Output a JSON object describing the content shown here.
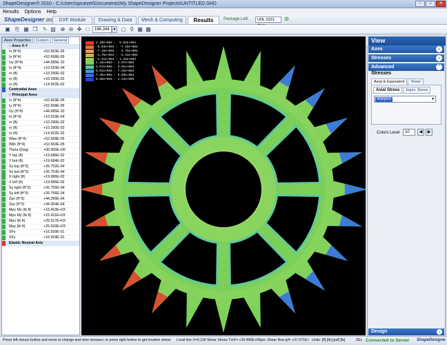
{
  "window": {
    "title": "ShapeDesigner® 2010 - C:\\Users\\qzuezet\\Documents\\My ShapeDesigner Projects\\UNTITLED.SHD"
  },
  "menu": [
    "Results",
    "Options",
    "Help"
  ],
  "brand": {
    "name": "ShapeDesigner",
    "year": "2010"
  },
  "module_tabs": [
    {
      "label": "DXF Module"
    },
    {
      "label": "Drawing & Data"
    },
    {
      "label": "Mesh & Computing"
    },
    {
      "label": "Results",
      "active": true
    }
  ],
  "package": {
    "label": "Package Left:",
    "value": "UNL  1023 days"
  },
  "toolbar": {
    "icons": [
      "save-icon",
      "print-icon",
      "preview-icon",
      "pencil-icon",
      "grid-icon",
      "zoom-in-icon",
      "zoom-out-icon",
      "pan-icon",
      "zoom-window-icon"
    ],
    "zoom_value": "166.344"
  },
  "left_panel": {
    "tabs": [
      "Axes Properties",
      "Custom",
      "General"
    ],
    "rows": [
      {
        "kind": "section",
        "name": "Axes X-Y",
        "expanded": true
      },
      {
        "kind": "item",
        "mark": "g",
        "name": "Ix      (ft^4)",
        "value": "+52.663E-05"
      },
      {
        "kind": "item",
        "mark": "g",
        "name": "Iy      (ft^4)",
        "value": "+52.668E-05"
      },
      {
        "kind": "item",
        "mark": "g",
        "name": "Ixy     (ft^4)",
        "value": "+44.685E-10"
      },
      {
        "kind": "item",
        "mark": "g",
        "name": "Io      (ft^4)",
        "value": "+10.533E-04"
      },
      {
        "kind": "item",
        "mark": "g",
        "name": "rx      (ft)",
        "value": "+10.290E-02"
      },
      {
        "kind": "item",
        "mark": "g",
        "name": "ry      (ft)",
        "value": "+10.290E-02"
      },
      {
        "kind": "item",
        "mark": "g",
        "name": "ro      (ft)",
        "value": "+14.552E-02"
      },
      {
        "kind": "section",
        "mark": "b",
        "name": "Centroidal Axes"
      },
      {
        "kind": "section",
        "name": "Principal Axes",
        "expanded": true
      },
      {
        "kind": "item",
        "mark": "g",
        "name": "Ix      (ft^4)",
        "value": "+52.663E-05"
      },
      {
        "kind": "item",
        "mark": "g",
        "name": "Iy      (ft^4)",
        "value": "+52.668E-05"
      },
      {
        "kind": "item",
        "mark": "g",
        "name": "Ixy     (ft^4)",
        "value": "+44.685E-10"
      },
      {
        "kind": "item",
        "mark": "g",
        "name": "Io      (ft^4)",
        "value": "+10.533E-04"
      },
      {
        "kind": "item",
        "mark": "g",
        "name": "rx      (ft)",
        "value": "+10.290E-02"
      },
      {
        "kind": "item",
        "mark": "g",
        "name": "ry      (ft)",
        "value": "+10.290E-02"
      },
      {
        "kind": "item",
        "mark": "g",
        "name": "ro      (ft)",
        "value": "+14.552E-02"
      },
      {
        "kind": "item",
        "mark": "g",
        "name": "IMax    (ft^4)",
        "value": "+52.668E-05"
      },
      {
        "kind": "item",
        "mark": "g",
        "name": "IMin    (ft^4)",
        "value": "+52.663E-05"
      },
      {
        "kind": "item",
        "mark": "g",
        "name": "Theta (Deg)",
        "value": "+00.000E+00"
      },
      {
        "kind": "item",
        "mark": "g",
        "name": "Y top   (ft)",
        "value": "+19.686E-02"
      },
      {
        "kind": "item",
        "mark": "g",
        "name": "Y bot   (ft)",
        "value": "+19.684E-02"
      },
      {
        "kind": "item",
        "mark": "g",
        "name": "Sx top  (ft^3)",
        "value": "+26.752E-04"
      },
      {
        "kind": "item",
        "mark": "g",
        "name": "Sx bot  (ft^3)",
        "value": "+26.753E-04"
      },
      {
        "kind": "item",
        "mark": "g",
        "name": "X right (ft)",
        "value": "+19.686E-02"
      },
      {
        "kind": "item",
        "mark": "g",
        "name": "X left  (ft)",
        "value": "+19.685E-02"
      },
      {
        "kind": "item",
        "mark": "g",
        "name": "Sy right (ft^3)",
        "value": "+26.755E-04"
      },
      {
        "kind": "item",
        "mark": "g",
        "name": "Sy left (ft^3)",
        "value": "+26.756E-04"
      },
      {
        "kind": "item",
        "mark": "g",
        "name": "Zpx     (ft^3)",
        "value": "+44.299E-04"
      },
      {
        "kind": "item",
        "mark": "g",
        "name": "Zpy     (ft^3)",
        "value": "+44.304E-04"
      },
      {
        "kind": "item",
        "mark": "g",
        "name": "Mpx Mx (lb ft)",
        "value": "+15.410E+03"
      },
      {
        "kind": "item",
        "mark": "g",
        "name": "Mpx My (lb ft)",
        "value": "+15.411E+03"
      },
      {
        "kind": "item",
        "mark": "g",
        "name": "Mpx     (lb ft)",
        "value": "+25.517E+03"
      },
      {
        "kind": "item",
        "mark": "g",
        "name": "Mpy     (lb ft)",
        "value": "+25.520E+03"
      },
      {
        "kind": "item",
        "mark": "g",
        "name": "SFx",
        "value": "+16.559E-01"
      },
      {
        "kind": "item",
        "mark": "g",
        "name": "SFy",
        "value": "+16.559E-01"
      },
      {
        "kind": "section",
        "mark": "r",
        "name": "Elastic Neutral Axis"
      }
    ]
  },
  "legend": {
    "colors": [
      "#e83a2a",
      "#ee6b3c",
      "#f09848",
      "#c8b84c",
      "#9acd56",
      "#78d25a",
      "#58c9a2",
      "#3f9ae0",
      "#2f6cf0",
      "#2446d8"
    ],
    "labels": [
      "1.20e+004 : -9.63e+004",
      "-9.63e+004 : -7.19e+004",
      "-7.19e+004 : -4.75e+004",
      "-4.75e+004 : -2.31e+004",
      "-2.31e+004 : 1.33e+003",
      "1.33e+003 : 2.57e+004",
      "2.57e+004 : 5.01e+004",
      "5.01e+004 : 7.45e+004",
      "7.45e+004 : 9.89e+004",
      "9.89e+004 : 1.23e+005"
    ]
  },
  "right_panel": {
    "title": "View",
    "sections": [
      "Axes",
      "Stresses",
      "Advanced"
    ],
    "stresses_label": "Stresses",
    "tabs": [
      "Axial & Equivalent",
      "Shear"
    ],
    "subtabs": [
      "Axial Stress",
      "Equiv. Stress"
    ],
    "warp_select": "Warped",
    "colors_level_label": "Colors Level",
    "colors_level_value": "10",
    "design_label": "Design"
  },
  "status": {
    "hint": "Press left mouse button and move to change and view stresses; or press right button to get location stress",
    "local": "Local line X=0.11ft Shear Stress Tx/X= +29.496E+00psi- Shear flow q/l= +27.071E-01lb/ft",
    "units": "Units: [ft] [lb] [psf] [lb]",
    "server_prefix": "ZEL",
    "server": "Connected to Server",
    "logo": "ShapeDesigner"
  }
}
